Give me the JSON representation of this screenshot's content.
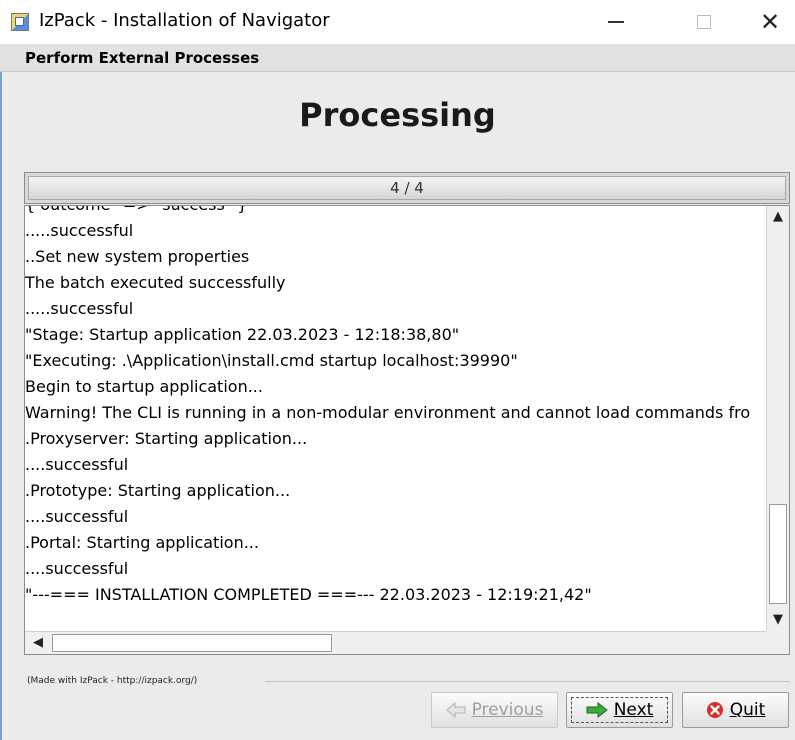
{
  "window": {
    "title": "IzPack - Installation of  Navigator",
    "controls": {
      "minimize": "—",
      "maximize": "☐",
      "close": "✕"
    }
  },
  "panel": {
    "title": "Perform External Processes",
    "heading": "Processing"
  },
  "progress": {
    "label": "4 / 4",
    "fraction": 1.0
  },
  "log": {
    "lines": [
      "{ outcome\" => \"success\" }",
      ".....successful",
      "..Set new system properties",
      "The batch executed successfully",
      ".....successful",
      "\"Stage: Startup application 22.03.2023 - 12:18:38,80\"",
      "\"Executing: .\\Application\\install.cmd startup localhost:39990\"",
      "Begin to startup application...",
      "Warning! The CLI is running in a non-modular environment and cannot load commands fro",
      ".Proxyserver: Starting application...",
      "....successful",
      ".Prototype: Starting application...",
      "....successful",
      ".Portal: Starting application...",
      "....successful",
      "\"---=== INSTALLATION COMPLETED ===--- 22.03.2023 - 12:19:21,42\""
    ]
  },
  "scrollbars": {
    "up": "▲",
    "down": "▼",
    "left": "◀",
    "right": "▶"
  },
  "footer": {
    "made_with": "(Made with IzPack - http://izpack.org/)"
  },
  "buttons": {
    "previous": {
      "label": "Previous",
      "enabled": false
    },
    "next": {
      "label": "Next",
      "enabled": true
    },
    "quit": {
      "label": "Quit",
      "enabled": true
    }
  },
  "colors": {
    "accent": "#7aa0d8",
    "quit_icon": "#d62d2d",
    "next_icon": "#3cab3c"
  }
}
